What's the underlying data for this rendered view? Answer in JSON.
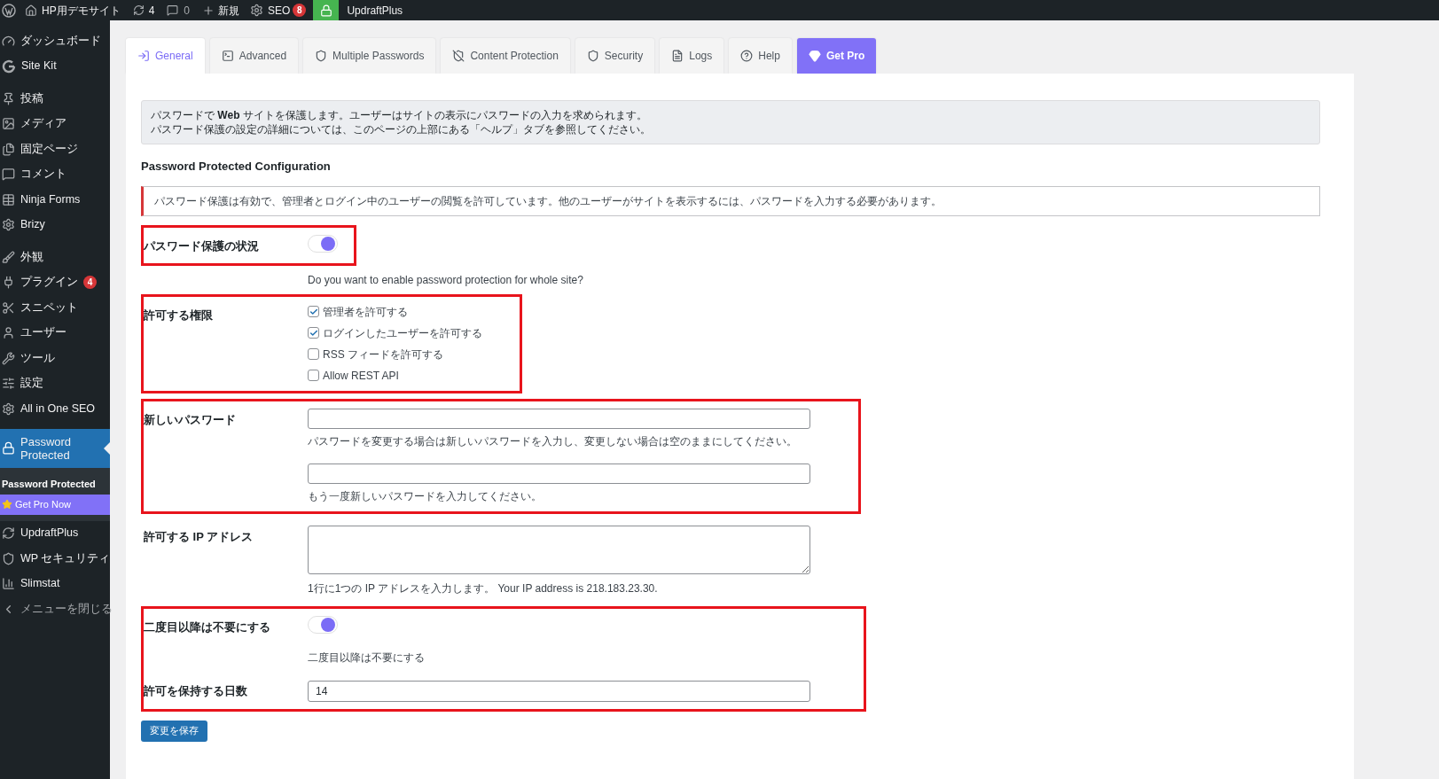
{
  "admin_bar": {
    "site": "HP用デモサイト",
    "updates": "4",
    "comments": "0",
    "new": "新規",
    "seo": "SEO",
    "seo_badge": "8",
    "updraft": "UpdraftPlus"
  },
  "sidebar": {
    "groups": [
      [
        {
          "label": "ダッシュボード"
        },
        {
          "label": "Site Kit"
        }
      ],
      [
        {
          "label": "投稿"
        },
        {
          "label": "メディア"
        },
        {
          "label": "固定ページ"
        },
        {
          "label": "コメント"
        },
        {
          "label": "Ninja Forms"
        },
        {
          "label": "Brizy"
        }
      ],
      [
        {
          "label": "外観"
        },
        {
          "label": "プラグイン",
          "badge": "4"
        },
        {
          "label": "スニペット"
        },
        {
          "label": "ユーザー"
        },
        {
          "label": "ツール"
        },
        {
          "label": "設定"
        },
        {
          "label": "All in One SEO"
        }
      ],
      [
        {
          "label": "Password Protected",
          "selected": true,
          "children": [
            {
              "label": "Password Protected",
              "kind": "current"
            },
            {
              "label": "Get Pro Now",
              "kind": "promo"
            }
          ]
        },
        {
          "label": "UpdraftPlus",
          "selected": false
        },
        {
          "label": "WP セキュリティ",
          "selected": false
        },
        {
          "label": "Slimstat",
          "selected": false
        },
        {
          "label": "メニューを閉じる",
          "kind": "collapse",
          "selected": false
        }
      ]
    ]
  },
  "tabs": [
    {
      "label": "General",
      "selected": true,
      "kind": "normal"
    },
    {
      "label": "Advanced",
      "selected": false,
      "kind": "normal"
    },
    {
      "label": "Multiple Passwords",
      "selected": false,
      "kind": "normal"
    },
    {
      "label": "Content Protection",
      "selected": false,
      "kind": "normal"
    },
    {
      "label": "Security",
      "selected": false,
      "kind": "normal"
    },
    {
      "label": "Logs",
      "selected": false,
      "kind": "normal"
    },
    {
      "label": "Help",
      "selected": false,
      "kind": "normal"
    },
    {
      "label": "Get Pro",
      "selected": false,
      "kind": "pro"
    }
  ],
  "intro": [
    "パスワードで **Web** サイトを保護します。ユーザーはサイトの表示にパスワードの入力を求められます。",
    "パスワード保護の設定の詳細については、このページの上部にある「ヘルプ」タブを参照してください。"
  ],
  "section_title": "Password Protected Configuration",
  "notice": "パスワード保護は有効で、管理者とログイン中のユーザーの閲覧を許可しています。他のユーザーがサイトを表示するには、パスワードを入力する必要があります。",
  "sections": [
    {
      "highlighted": true,
      "rows": [
        {
          "kind": "toggle",
          "label": "パスワード保護の状況",
          "on": true
        }
      ]
    },
    {
      "highlighted": false,
      "rows": [
        {
          "kind": "note",
          "description": "Do you want to enable password protection for whole site?"
        }
      ]
    },
    {
      "highlighted": true,
      "rows": [
        {
          "kind": "checkboxes",
          "label": "許可する権限",
          "options": [
            {
              "label": "管理者を許可する",
              "checked": true
            },
            {
              "label": "ログインしたユーザーを許可する",
              "checked": true
            },
            {
              "label": "RSS フィードを許可する",
              "checked": false
            },
            {
              "label": "Allow REST API",
              "checked": false
            }
          ]
        }
      ]
    },
    {
      "highlighted": true,
      "rows": [
        {
          "kind": "passwords",
          "label": "新しいパスワード",
          "description": "パスワードを変更する場合は新しいパスワードを入力し、変更しない場合は空のままにしてください。",
          "description2": "もう一度新しいパスワードを入力してください。"
        }
      ]
    },
    {
      "highlighted": false,
      "rows": [
        {
          "kind": "textarea",
          "label": "許可する IP アドレス",
          "description": "1行に1つの IP アドレスを入力します。 Your IP address is 218.183.23.30."
        }
      ]
    },
    {
      "highlighted": true,
      "rows": [
        {
          "kind": "toggle",
          "label": "二度目以降は不要にする",
          "on": true,
          "description": "二度目以降は不要にする"
        },
        {
          "kind": "text",
          "label": "許可を保持する日数",
          "value": "14"
        }
      ]
    }
  ],
  "save_button": "変更を保存"
}
